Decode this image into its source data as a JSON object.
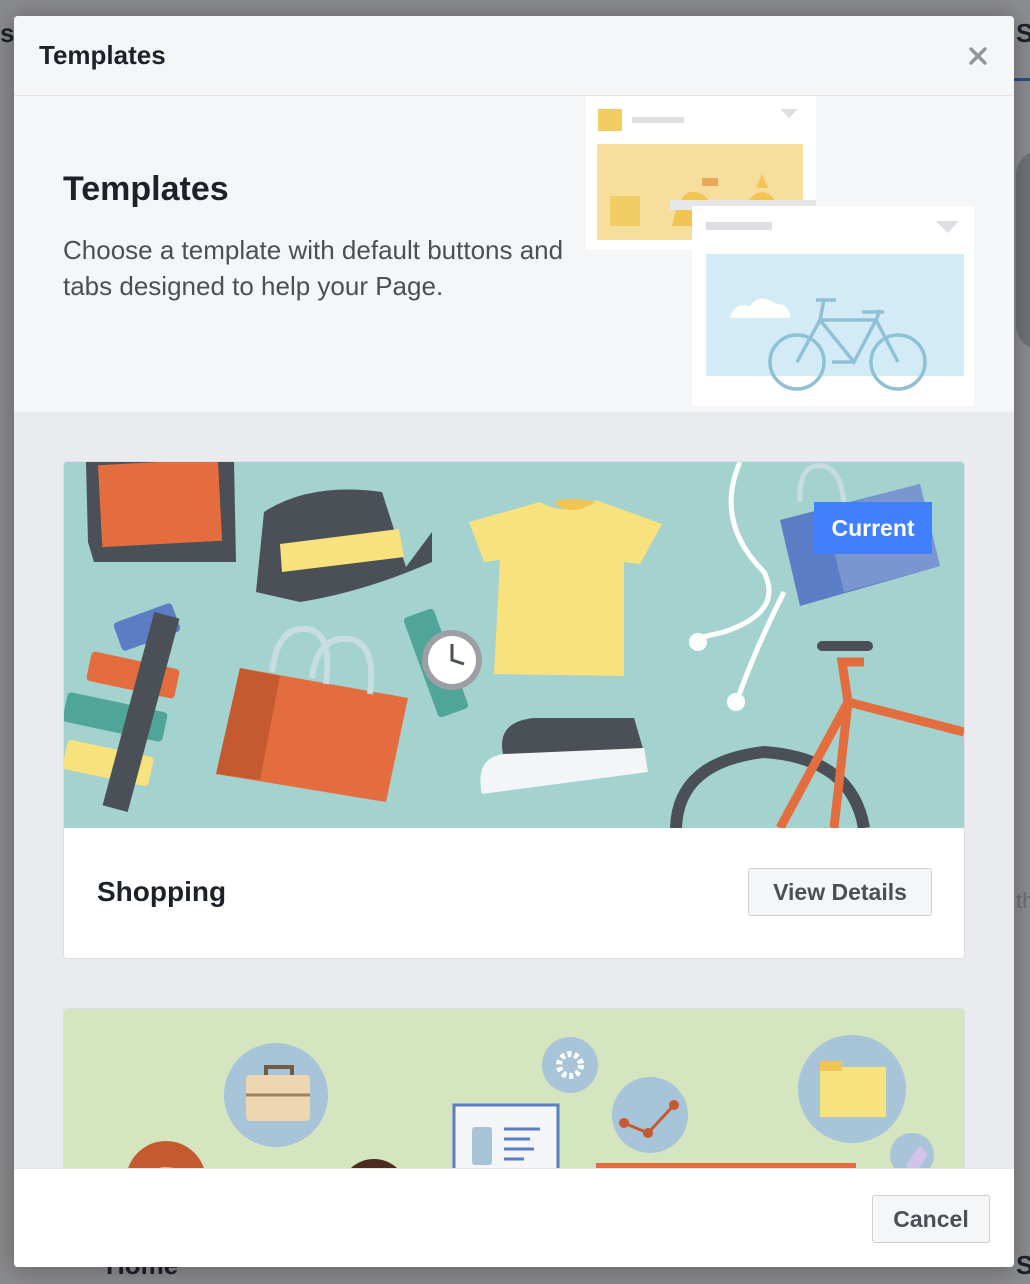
{
  "dialog": {
    "title": "Templates",
    "close_icon": "close-icon",
    "intro": {
      "heading": "Templates",
      "description": "Choose a template with default buttons and tabs designed to help your Page."
    },
    "templates": [
      {
        "name": "Shopping",
        "badge": "Current",
        "action_label": "View Details"
      },
      {
        "name": "",
        "badge": "",
        "action_label": ""
      }
    ],
    "footer": {
      "cancel_label": "Cancel"
    }
  },
  "background": {
    "left_fragment": "s",
    "right_fragment": "S",
    "mid_right_fragment": "th",
    "bottom_fragment": "Home",
    "bottom_right_fragment": "S"
  },
  "colors": {
    "accent": "#4080ff",
    "shopping_bg": "#a3d2cf",
    "services_bg": "#d5e5bf",
    "header_bg": "#f5f6f7",
    "body_bg": "#e9ebee"
  }
}
